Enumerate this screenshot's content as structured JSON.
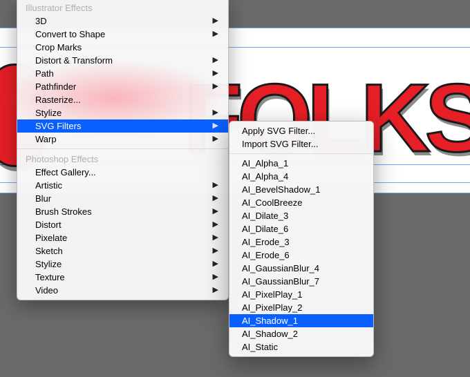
{
  "artwork": {
    "text": "FOLKS"
  },
  "menu": {
    "header1": "Illustrator Effects",
    "items1": [
      {
        "label": "3D",
        "submenu": true,
        "highlight": false
      },
      {
        "label": "Convert to Shape",
        "submenu": true,
        "highlight": false
      },
      {
        "label": "Crop Marks",
        "submenu": false,
        "highlight": false
      },
      {
        "label": "Distort & Transform",
        "submenu": true,
        "highlight": false
      },
      {
        "label": "Path",
        "submenu": true,
        "highlight": false
      },
      {
        "label": "Pathfinder",
        "submenu": true,
        "highlight": false
      },
      {
        "label": "Rasterize...",
        "submenu": false,
        "highlight": false
      },
      {
        "label": "Stylize",
        "submenu": true,
        "highlight": false
      },
      {
        "label": "SVG Filters",
        "submenu": true,
        "highlight": true
      },
      {
        "label": "Warp",
        "submenu": true,
        "highlight": false
      }
    ],
    "header2": "Photoshop Effects",
    "items2": [
      {
        "label": "Effect Gallery...",
        "submenu": false
      },
      {
        "label": "Artistic",
        "submenu": true
      },
      {
        "label": "Blur",
        "submenu": true
      },
      {
        "label": "Brush Strokes",
        "submenu": true
      },
      {
        "label": "Distort",
        "submenu": true
      },
      {
        "label": "Pixelate",
        "submenu": true
      },
      {
        "label": "Sketch",
        "submenu": true
      },
      {
        "label": "Stylize",
        "submenu": true
      },
      {
        "label": "Texture",
        "submenu": true
      },
      {
        "label": "Video",
        "submenu": true
      }
    ]
  },
  "submenu": {
    "actions": [
      "Apply SVG Filter...",
      "Import SVG Filter..."
    ],
    "filters": [
      {
        "label": "AI_Alpha_1",
        "highlight": false
      },
      {
        "label": "AI_Alpha_4",
        "highlight": false
      },
      {
        "label": "AI_BevelShadow_1",
        "highlight": false
      },
      {
        "label": "AI_CoolBreeze",
        "highlight": false
      },
      {
        "label": "AI_Dilate_3",
        "highlight": false
      },
      {
        "label": "AI_Dilate_6",
        "highlight": false
      },
      {
        "label": "AI_Erode_3",
        "highlight": false
      },
      {
        "label": "AI_Erode_6",
        "highlight": false
      },
      {
        "label": "AI_GaussianBlur_4",
        "highlight": false
      },
      {
        "label": "AI_GaussianBlur_7",
        "highlight": false
      },
      {
        "label": "AI_PixelPlay_1",
        "highlight": false
      },
      {
        "label": "AI_PixelPlay_2",
        "highlight": false
      },
      {
        "label": "AI_Shadow_1",
        "highlight": true
      },
      {
        "label": "AI_Shadow_2",
        "highlight": false
      },
      {
        "label": "AI_Static",
        "highlight": false
      }
    ]
  }
}
